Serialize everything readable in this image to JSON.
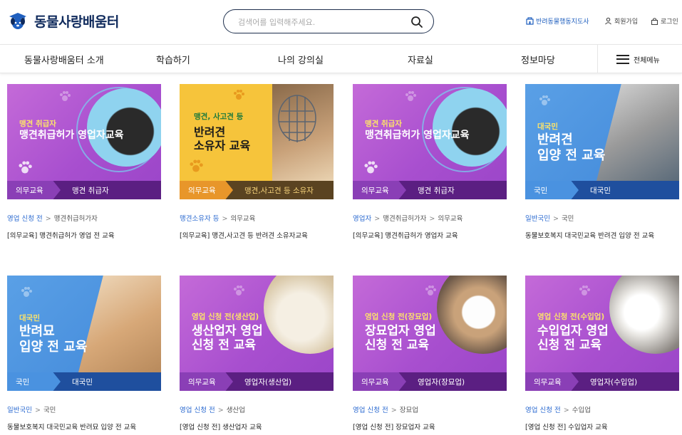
{
  "header": {
    "logo_text": "동물사랑배움터",
    "search_placeholder": "검색어를 입력해주세요.",
    "util_map": "반려동물행동지도사",
    "util_join": "회원가입",
    "util_login": "로그인"
  },
  "nav": {
    "items": [
      "동물사랑배움터 소개",
      "학습하기",
      "나의 강의실",
      "자료실",
      "정보마당"
    ],
    "all_menu": "전체메뉴"
  },
  "colors": {
    "purple": "#a84fcf",
    "purple_band": "#5b1f82",
    "yellow": "#f6c43b",
    "blue": "#3f86d8",
    "blue_band": "#1f4f9e",
    "accent_link": "#2b6ad0"
  },
  "cards": [
    {
      "thumb_label": "맹견 취급자",
      "thumb_title": "맹견취급허가 영업자교육",
      "band_left": "의무교육",
      "band_right": "맹견 취급자",
      "crumb_first": "영업 신청 전",
      "crumb_rest": [
        "맹견취급허가자"
      ],
      "title": "[의무교육] 맹견취급허가 영업 전 교육",
      "icon": "black-dog-photo"
    },
    {
      "thumb_label": "맹견, 사고견 등",
      "thumb_title": "반려견\n소유자 교육",
      "band_left": "의무교육",
      "band_right": "맹견,사고견 등 소유자",
      "crumb_first": "맹견소유자 등",
      "crumb_rest": [
        "의무교육"
      ],
      "title": "[의무교육] 맹견,사고견 등 반려견 소유자교육",
      "icon": "muzzled-dog-photo"
    },
    {
      "thumb_label": "맹견 취급자",
      "thumb_title": "맹견취급허가 영업자교육",
      "band_left": "의무교육",
      "band_right": "맹견 취급자",
      "crumb_first": "영업자",
      "crumb_rest": [
        "맹견취급허가자",
        "의무교육"
      ],
      "title": "[의무교육] 맹견취급허가 영업자 교육",
      "icon": "black-dog-photo"
    },
    {
      "thumb_label": "대국민",
      "thumb_title": "반려견\n입양 전 교육",
      "band_left": "국민",
      "band_right": "대국민",
      "crumb_first": "일반국민",
      "crumb_rest": [
        "국민"
      ],
      "title": "동물보호복지 대국민교육 반려견 입양 전 교육",
      "icon": "poodle-photo"
    },
    {
      "thumb_label": "대국민",
      "thumb_title": "반려묘\n입양 전 교육",
      "band_left": "국민",
      "band_right": "대국민",
      "crumb_first": "일반국민",
      "crumb_rest": [
        "국민"
      ],
      "title": "동물보호복지 대국민교육 반려묘 입양 전 교육",
      "icon": "cat-photo"
    },
    {
      "thumb_label": "영업 신청 전(생산업)",
      "thumb_title": "생산업자 영업\n신청 전 교육",
      "band_left": "의무교육",
      "band_right": "영업자(생산업)",
      "crumb_first": "영업 신청 전",
      "crumb_rest": [
        "생산업"
      ],
      "title": "[영업 신청 전] 생산업자 교육",
      "icon": "puppies-photo"
    },
    {
      "thumb_label": "영업 신청 전(장묘업)",
      "thumb_title": "장묘업자 영업\n신청 전 교육",
      "band_left": "의무교육",
      "band_right": "영업자(장묘업)",
      "crumb_first": "영업 신청 전",
      "crumb_rest": [
        "장묘업"
      ],
      "title": "[영업 신청 전] 장묘업자 교육",
      "icon": "memorial-photo"
    },
    {
      "thumb_label": "영업 신청 전(수입업)",
      "thumb_title": "수입업자 영업\n신청 전 교육",
      "band_left": "의무교육",
      "band_right": "영업자(수입업)",
      "crumb_first": "영업 신청 전",
      "crumb_rest": [
        "수입업"
      ],
      "title": "[영업 신청 전] 수입업자 교육",
      "icon": "dog-cat-photo"
    }
  ]
}
